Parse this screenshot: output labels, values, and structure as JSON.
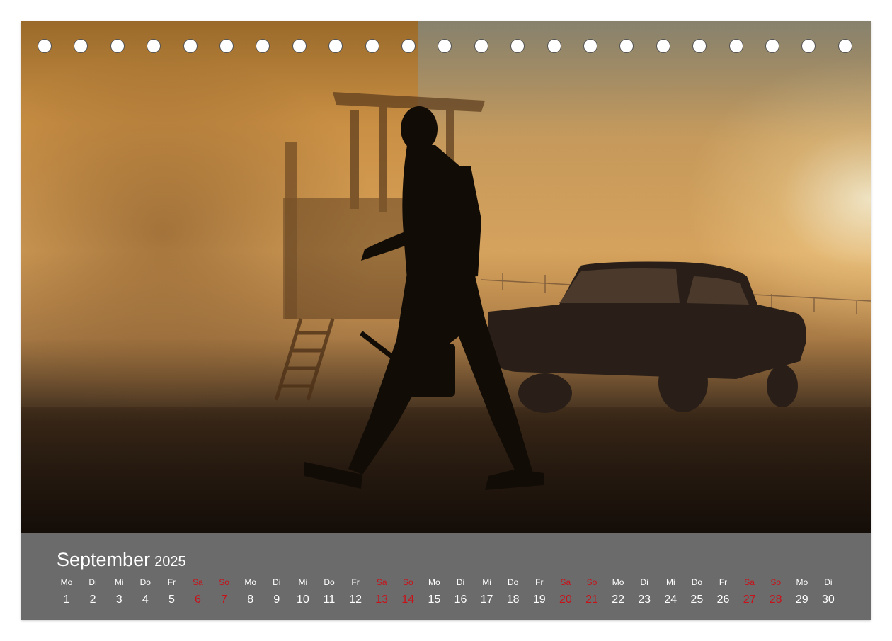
{
  "calendar": {
    "month": "September",
    "year": "2025",
    "weekend_color": "#c8121a",
    "text_color": "#ffffff",
    "days": [
      {
        "wd": "Mo",
        "d": "1",
        "weekend": false
      },
      {
        "wd": "Di",
        "d": "2",
        "weekend": false
      },
      {
        "wd": "Mi",
        "d": "3",
        "weekend": false
      },
      {
        "wd": "Do",
        "d": "4",
        "weekend": false
      },
      {
        "wd": "Fr",
        "d": "5",
        "weekend": false
      },
      {
        "wd": "Sa",
        "d": "6",
        "weekend": true
      },
      {
        "wd": "So",
        "d": "7",
        "weekend": true
      },
      {
        "wd": "Mo",
        "d": "8",
        "weekend": false
      },
      {
        "wd": "Di",
        "d": "9",
        "weekend": false
      },
      {
        "wd": "Mi",
        "d": "10",
        "weekend": false
      },
      {
        "wd": "Do",
        "d": "11",
        "weekend": false
      },
      {
        "wd": "Fr",
        "d": "12",
        "weekend": false
      },
      {
        "wd": "Sa",
        "d": "13",
        "weekend": true
      },
      {
        "wd": "So",
        "d": "14",
        "weekend": true
      },
      {
        "wd": "Mo",
        "d": "15",
        "weekend": false
      },
      {
        "wd": "Di",
        "d": "16",
        "weekend": false
      },
      {
        "wd": "Mi",
        "d": "17",
        "weekend": false
      },
      {
        "wd": "Do",
        "d": "18",
        "weekend": false
      },
      {
        "wd": "Fr",
        "d": "19",
        "weekend": false
      },
      {
        "wd": "Sa",
        "d": "20",
        "weekend": true
      },
      {
        "wd": "So",
        "d": "21",
        "weekend": true
      },
      {
        "wd": "Mo",
        "d": "22",
        "weekend": false
      },
      {
        "wd": "Di",
        "d": "23",
        "weekend": false
      },
      {
        "wd": "Mi",
        "d": "24",
        "weekend": false
      },
      {
        "wd": "Do",
        "d": "25",
        "weekend": false
      },
      {
        "wd": "Fr",
        "d": "26",
        "weekend": false
      },
      {
        "wd": "Sa",
        "d": "27",
        "weekend": true
      },
      {
        "wd": "So",
        "d": "28",
        "weekend": true
      },
      {
        "wd": "Mo",
        "d": "29",
        "weekend": false
      },
      {
        "wd": "Di",
        "d": "30",
        "weekend": false
      }
    ]
  },
  "binding": {
    "hole_count": 23
  },
  "colors": {
    "panel": "#6b6b6b",
    "dust": "#d8a25a"
  }
}
